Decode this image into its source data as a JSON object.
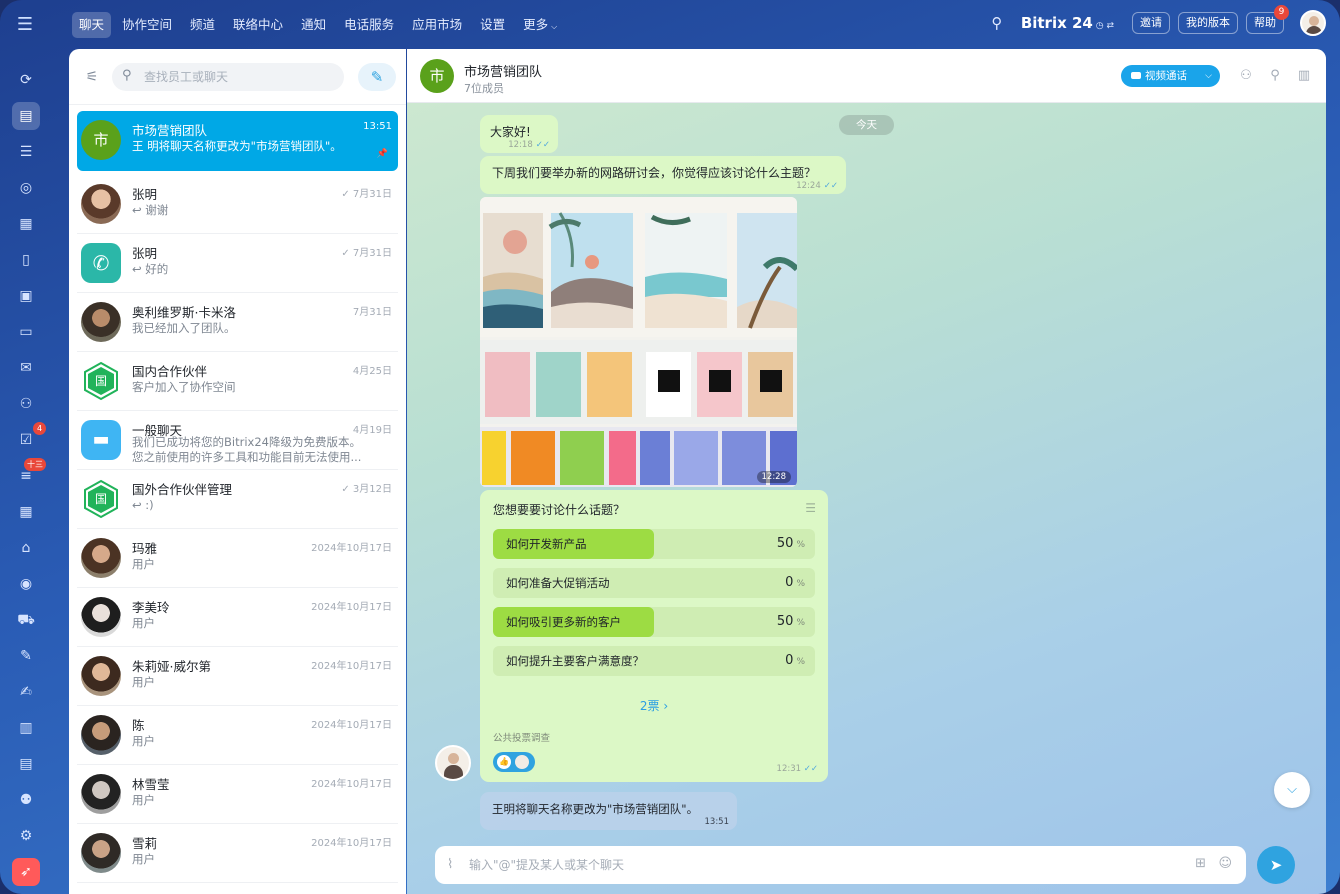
{
  "topbar": {
    "menu_icon": "hamburger-icon",
    "nav": [
      "聊天",
      "协作空间",
      "频道",
      "联络中心",
      "通知",
      "电话服务",
      "应用市场",
      "设置",
      "更多"
    ],
    "brand": "Bitrix 24",
    "invite": "邀请",
    "my_plan": "我的版本",
    "help": "帮助",
    "help_badge": "9"
  },
  "rail": {
    "tasks_badge": "4",
    "feed_badge": "十三"
  },
  "list": {
    "search_placeholder": "查找员工或聊天",
    "items": [
      {
        "name": "市场营销团队",
        "sub": "王 明将聊天名称更改为\"市场营销团队\"。",
        "time": "13:51",
        "avatar": "市"
      },
      {
        "name": "张明",
        "sub": "↩ 谢谢",
        "time": "✓ 7月31日"
      },
      {
        "name": "张明",
        "sub": "↩ 好的",
        "time": "✓ 7月31日"
      },
      {
        "name": "奥利维罗斯·卡米洛",
        "sub": "我已经加入了团队。",
        "time": "7月31日"
      },
      {
        "name": "国内合作伙伴",
        "sub": "客户加入了协作空间",
        "time": "4月25日",
        "avatar": "国"
      },
      {
        "name": "一般聊天",
        "sub": "我们已成功将您的Bitrix24降级为免费版本。",
        "sub2": "您之前使用的许多工具和功能目前无法使用...",
        "time": "4月19日"
      },
      {
        "name": "国外合作伙伴管理",
        "sub": "↩ :)",
        "time": "✓ 3月12日",
        "avatar": "国"
      },
      {
        "name": "玛雅",
        "sub": "用户",
        "time": "2024年10月17日"
      },
      {
        "name": "李美玲",
        "sub": "用户",
        "time": "2024年10月17日"
      },
      {
        "name": "朱莉娅·威尔第",
        "sub": "用户",
        "time": "2024年10月17日"
      },
      {
        "name": "陈",
        "sub": "用户",
        "time": "2024年10月17日"
      },
      {
        "name": "林雪莹",
        "sub": "用户",
        "time": "2024年10月17日"
      },
      {
        "name": "雪莉",
        "sub": "用户",
        "time": "2024年10月17日"
      }
    ]
  },
  "chat": {
    "avatar": "市",
    "title": "市场营销团队",
    "members": "7位成员",
    "video_call": "视频通话",
    "date_divider": "今天",
    "msg1": {
      "text": "大家好!",
      "time": "12:18"
    },
    "msg2": {
      "text": "下周我们要举办新的网路研讨会，你觉得应该讨论什么主题？",
      "time": "12:24"
    },
    "image_time": "12:28",
    "poll": {
      "question": "您想要要讨论什么话题？",
      "options": [
        {
          "label": "如何开发新产品",
          "percent": "50",
          "fill": 0.5
        },
        {
          "label": "如何准备大促销活动",
          "percent": "0",
          "fill": 0
        },
        {
          "label": "如何吸引更多新的客户",
          "percent": "50",
          "fill": 0.5
        },
        {
          "label": "如何提升主要客户满意度？",
          "percent": "0",
          "fill": 0
        }
      ],
      "pct_sign": "%",
      "votes": "2票",
      "public_label": "公共投票调查",
      "time": "12:31"
    },
    "system_msg": {
      "text": "王明将聊天名称更改为\"市场营销团队\"。",
      "time": "13:51"
    },
    "composer_placeholder": "输入\"@\"提及某人或某个聊天"
  }
}
